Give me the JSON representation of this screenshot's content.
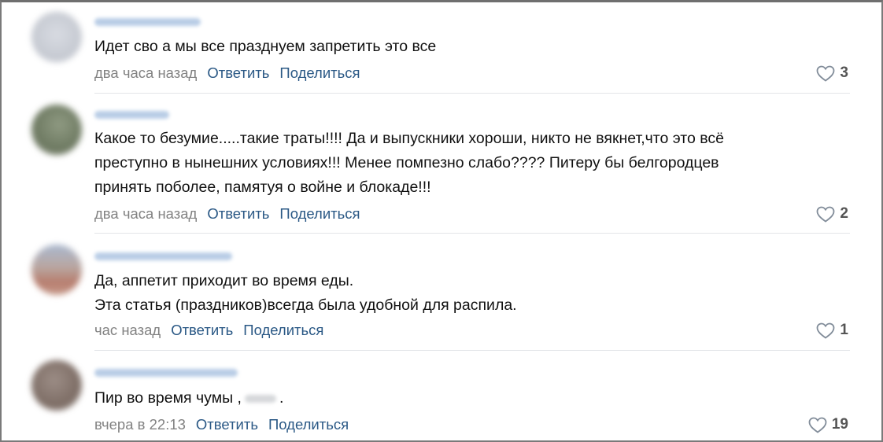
{
  "comments": [
    {
      "lines": [
        "Идет сво а мы все празднуем запретить это все"
      ],
      "time": "два часа назад",
      "reply": "Ответить",
      "share": "Поделиться",
      "likes": "3",
      "avatar_color": "#c9ccd4"
    },
    {
      "lines": [
        "Какое то безумие.....такие траты!!!! Да и выпускники хороши, никто не вякнет,что это всё",
        "преступно в нынешних условиях!!! Менее помпезно слабо???? Питеру бы белгородцев",
        "принять поболее, памятуя о войне и блокаде!!!"
      ],
      "time": "два часа назад",
      "reply": "Ответить",
      "share": "Поделиться",
      "likes": "2",
      "avatar_color": "#7d8a6e"
    },
    {
      "lines": [
        "Да, аппетит приходит во время еды.",
        "Эта статья (праздников)всегда была удобной для распила."
      ],
      "time": "час назад",
      "reply": "Ответить",
      "share": "Поделиться",
      "likes": "1",
      "avatar_color": "#b48a7a"
    },
    {
      "lines": [
        "Пир во время чумы ,"
      ],
      "line_suffix": ".",
      "time": "вчера в 22:13",
      "reply": "Ответить",
      "share": "Поделиться",
      "likes": "19",
      "avatar_color": "#8a7a72"
    }
  ]
}
